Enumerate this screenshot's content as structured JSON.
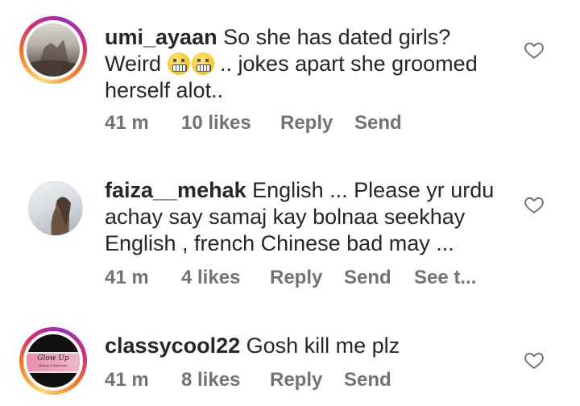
{
  "comments": [
    {
      "username": "umi_ayaan",
      "text_before_emoji": " So she has dated girls? Weird ",
      "text_after_emoji": " .. jokes apart she groomed herself alot..",
      "emoji": "grimacing-face",
      "time": "41 m",
      "likes": "10 likes",
      "reply": "Reply",
      "send": "Send",
      "avatar_ring": true
    },
    {
      "username": "faiza__mehak",
      "text": " English ... Please yr urdu achay say samaj kay bolnaa seekhay English , french Chinese bad may ...",
      "time": "41 m",
      "likes": "4 likes",
      "reply": "Reply",
      "send": "Send",
      "see_translation": "See t...",
      "avatar_ring": false
    },
    {
      "username": "classycool22",
      "text": " Gosh kill me plz",
      "time": "41 m",
      "likes": "8 likes",
      "reply": "Reply",
      "send": "Send",
      "avatar_ring": true,
      "avatar_logo_text": "Glow Up",
      "avatar_logo_subtext": "Beauty & Makeover"
    }
  ],
  "icons": {
    "like": "heart-outline-icon"
  },
  "colors": {
    "text": "#262626",
    "meta": "#737373",
    "ring_start": "#feda75",
    "ring_end": "#962fbf"
  }
}
